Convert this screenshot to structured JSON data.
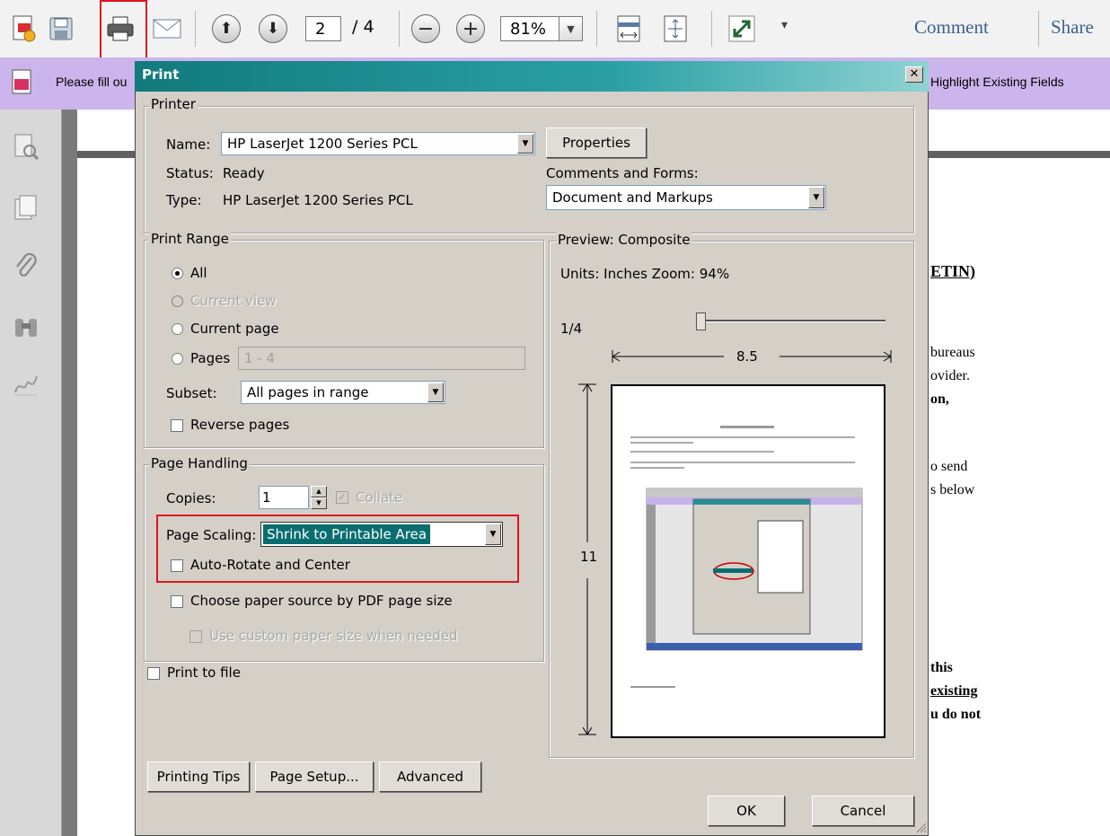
{
  "toolbar": {
    "page_current": "2",
    "page_total": "/ 4",
    "zoom": "81%",
    "comment_label": "Comment",
    "share_label": "Share"
  },
  "formbar": {
    "message": "Please fill ou",
    "highlight_label": "Highlight Existing Fields"
  },
  "document": {
    "lines": [
      "ETIN)",
      "bureaus",
      "ovider.",
      "on,",
      "o send",
      "s below",
      "this",
      "existing",
      "u do not"
    ]
  },
  "dialog": {
    "title": "Print",
    "printer": {
      "legend": "Printer",
      "name_label": "Name:",
      "name_value": "HP LaserJet 1200 Series PCL",
      "status_label": "Status:",
      "status_value": "Ready",
      "type_label": "Type:",
      "type_value": "HP LaserJet 1200 Series PCL",
      "properties_label": "Properties",
      "comments_label": "Comments and Forms:",
      "comments_value": "Document and Markups"
    },
    "print_range": {
      "legend": "Print Range",
      "all": "All",
      "current_view": "Current view",
      "current_page": "Current page",
      "pages": "Pages",
      "pages_value": "1 - 4",
      "subset_label": "Subset:",
      "subset_value": "All pages in range",
      "reverse": "Reverse pages"
    },
    "page_handling": {
      "legend": "Page Handling",
      "copies_label": "Copies:",
      "copies_value": "1",
      "collate": "Collate",
      "scaling_label": "Page Scaling:",
      "scaling_value": "Shrink to Printable Area",
      "auto_rotate": "Auto-Rotate and Center",
      "paper_source": "Choose paper source by PDF page size",
      "custom_paper": "Use custom paper size when needed"
    },
    "print_to_file": "Print to file",
    "preview": {
      "legend": "Preview: Composite",
      "units": "Units: Inches Zoom:  94%",
      "page_counter": "1/4",
      "width": "8.5",
      "height": "11"
    },
    "buttons": {
      "tips": "Printing Tips",
      "setup": "Page Setup...",
      "advanced": "Advanced",
      "ok": "OK",
      "cancel": "Cancel"
    }
  },
  "colors": {
    "title_gradient_start": "#117a7d",
    "formbar": "#ccb4ec",
    "highlight_red": "#e0141e",
    "selection": "#0a6e70"
  }
}
